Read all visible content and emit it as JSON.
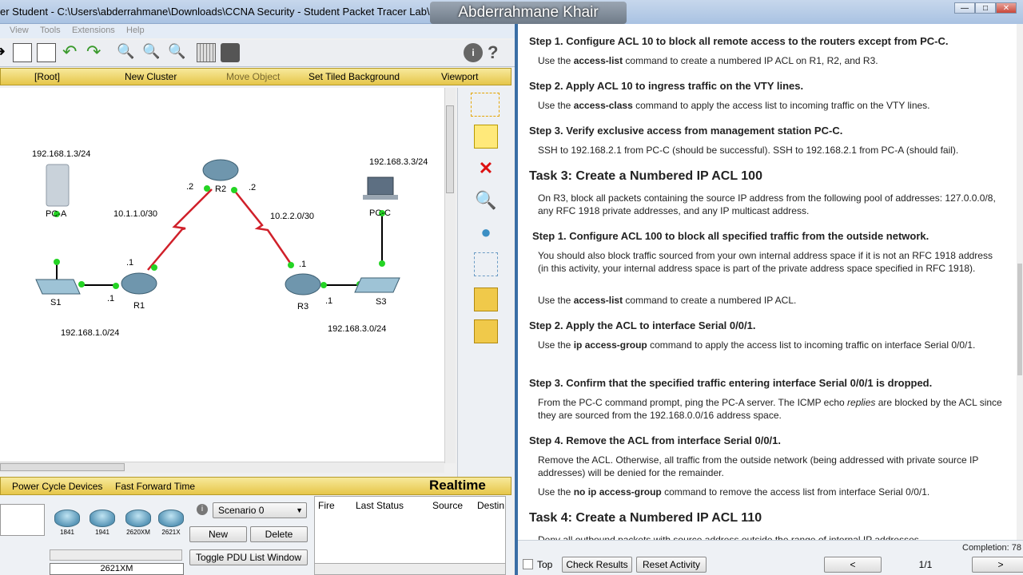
{
  "left": {
    "title": "er Student - C:\\Users\\abderrahmane\\Downloads\\CCNA Security - Student Packet Tracer Lab\\CCNA...",
    "menu": [
      "View",
      "Tools",
      "Extensions",
      "Help"
    ],
    "workspace_bar": [
      "[Root]",
      "New Cluster",
      "Move Object",
      "Set Tiled Background",
      "Viewport"
    ],
    "topology": {
      "labels": {
        "pca_ip": "192.168.1.3/24",
        "pcc_ip": "192.168.3.3/24",
        "net_r1r2": "10.1.1.0/30",
        "net_r2r3": "10.2.2.0/30",
        "lan1": "192.168.1.0/24",
        "lan3": "192.168.3.0/24",
        "r2_left": ".2",
        "r2_right": ".2",
        "r1_top": ".1",
        "r1_left": ".1",
        "r3_top": ".1",
        "r3_right": ".1"
      },
      "devices": {
        "pca": "PC-A",
        "pcc": "PC-C",
        "r1": "R1",
        "r2": "R2",
        "r3": "R3",
        "s1": "S1",
        "s3": "S3"
      }
    },
    "status": {
      "power": "Power Cycle Devices",
      "fast": "Fast Forward Time",
      "mode": "Realtime"
    },
    "device_models": [
      "1841",
      "1941",
      "2620XM",
      "2621X"
    ],
    "selected_model": "2621XM",
    "scenario": "Scenario 0",
    "new_label": "New",
    "delete_label": "Delete",
    "toggle_label": "Toggle PDU List Window",
    "pdu_columns": [
      "Fire",
      "Last Status",
      "Source",
      "Destin"
    ]
  },
  "right": {
    "name_badge": "Abderrahmane Khair",
    "steps": [
      {
        "h": "Step 1. Configure ACL 10 to block all remote access to the routers except from PC-C.",
        "p": "Use the access-list command to create a numbered IP ACL on R1, R2, and R3."
      },
      {
        "h": "Step 2. Apply ACL 10 to ingress traffic on the VTY lines.",
        "p": "Use the access-class command to apply the access list to incoming traffic on the VTY lines."
      },
      {
        "h": "Step 3. Verify exclusive access from management station PC-C.",
        "p": "SSH to 192.168.2.1 from PC-C (should be successful). SSH to 192.168.2.1 from PC-A (should fail)."
      }
    ],
    "task3": "Task 3: Create a Numbered IP ACL 100",
    "task3_p": "On R3, block all packets containing the source IP address from the following pool of addresses: 127.0.0.0/8, any RFC 1918 private addresses, and any IP multicast address.",
    "t3steps": [
      {
        "h": "Step 1. Configure ACL 100 to block all specified traffic from the outside network.",
        "p": "You should also block traffic sourced from your own internal address space if it is not an RFC 1918 address (in this activity, your internal address space is part of the private address space specified in RFC 1918).",
        "p2": "Use the access-list command to create a numbered IP ACL."
      },
      {
        "h": "Step 2. Apply the ACL to interface Serial 0/0/1.",
        "p": "Use the ip access-group command to apply the access list to incoming traffic on interface Serial 0/0/1."
      },
      {
        "h": "Step 3. Confirm that the specified traffic entering interface Serial 0/0/1 is dropped.",
        "p": "From the PC-C command prompt, ping the PC-A server. The ICMP echo replies are blocked by the ACL since they are sourced from the 192.168.0.0/16 address space."
      },
      {
        "h": "Step 4. Remove the ACL from interface Serial 0/0/1.",
        "p": "Remove the ACL. Otherwise, all traffic from the outside network (being addressed with private source IP addresses) will be denied for the remainder.",
        "p2": "Use the no ip access-group command to remove the access list from interface Serial 0/0/1."
      }
    ],
    "task4": "Task 4: Create a Numbered IP ACL 110",
    "task4_partial": "Deny all outbound packets with source address outside the range of internal IP addresses.",
    "completion": "Completion: 78",
    "footer": {
      "top": "Top",
      "check": "Check Results",
      "reset": "Reset Activity",
      "prev": "<",
      "page": "1/1",
      "next": ">"
    }
  }
}
